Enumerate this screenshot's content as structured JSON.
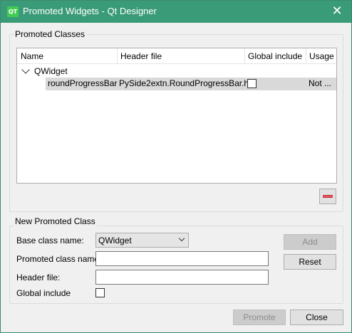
{
  "window": {
    "title": "Promoted Widgets - Qt Designer",
    "app_icon_text": "QT"
  },
  "promoted_classes": {
    "group_title": "Promoted Classes",
    "columns": [
      "Name",
      "Header file",
      "Global include",
      "Usage"
    ],
    "groups": [
      {
        "name": "QWidget",
        "expanded": true,
        "items": [
          {
            "name": "roundProgressBar",
            "header_file": "PySide2extn.RoundProgressBar.h",
            "global_include": false,
            "usage": "Not ..."
          }
        ]
      }
    ]
  },
  "new_promoted_class": {
    "group_title": "New Promoted Class",
    "base_class_label": "Base class name:",
    "base_class_value": "QWidget",
    "promoted_class_label": "Promoted class name:",
    "promoted_class_value": "",
    "header_file_label": "Header file:",
    "header_file_value": "",
    "global_include_label": "Global include",
    "global_include_checked": false,
    "add_label": "Add",
    "reset_label": "Reset"
  },
  "footer": {
    "promote_label": "Promote",
    "close_label": "Close"
  },
  "colors": {
    "titlebar": "#3a9b78",
    "selected_row": "#d9d9d9",
    "remove_icon": "#e8505b"
  }
}
